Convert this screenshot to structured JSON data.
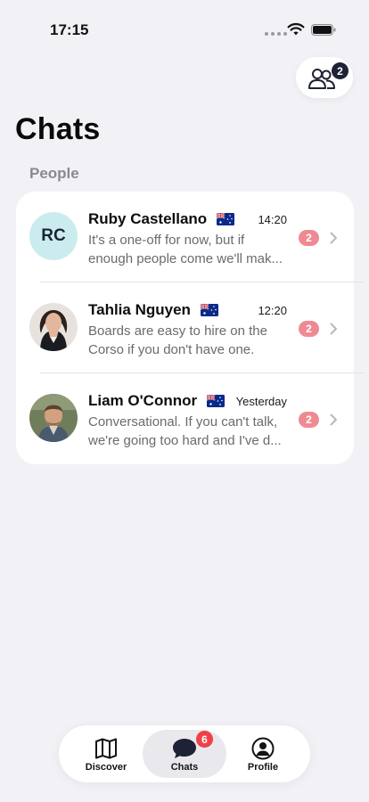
{
  "status": {
    "time": "17:15"
  },
  "header": {
    "friends_badge": "2"
  },
  "title": "Chats",
  "section": "People",
  "chats": [
    {
      "name": "Ruby Castellano",
      "initials": "RC",
      "time": "14:20",
      "preview": "It's a one-off for now, but if enough people come we'll mak...",
      "unread": "2"
    },
    {
      "name": "Tahlia Nguyen",
      "time": "12:20",
      "preview": "Boards are easy to hire on the Corso if you don't have one.",
      "unread": "2"
    },
    {
      "name": "Liam O'Connor",
      "time": "Yesterday",
      "preview": "Conversational. If you can't talk, we're going too hard and I've d...",
      "unread": "2"
    }
  ],
  "tabs": [
    {
      "label": "Discover",
      "icon": "map-icon"
    },
    {
      "label": "Chats",
      "icon": "chat-bubble-icon",
      "badge": "6"
    },
    {
      "label": "Profile",
      "icon": "profile-icon"
    }
  ],
  "colors": {
    "background": "#f2f1f6",
    "badge_unread": "#ef8a93",
    "tab_badge": "#ee4148",
    "initials_avatar": "#cbecef",
    "dark_accent": "#1e2235"
  }
}
